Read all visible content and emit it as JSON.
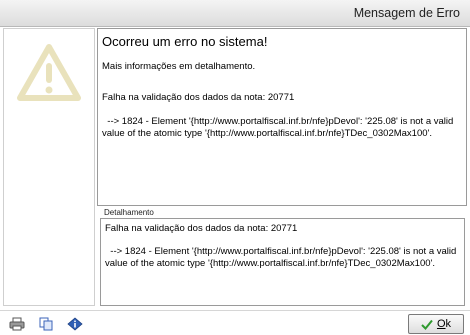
{
  "window": {
    "title": "Mensagem de Erro"
  },
  "message": {
    "heading": "Ocorreu um erro no sistema!",
    "more_info": "Mais informações em detalhamento.",
    "failure": "Falha na validação dos dados da nota: 20771",
    "detail": "  --> 1824 - Element '{http://www.portalfiscal.inf.br/nfe}pDevol': '225.08' is not a valid value of the atomic type '{http://www.portalfiscal.inf.br/nfe}TDec_0302Max100'."
  },
  "details": {
    "label": "Detalhamento",
    "failure": "Falha na validação dos dados da nota: 20771",
    "detail": "  --> 1824 - Element '{http://www.portalfiscal.inf.br/nfe}pDevol': '225.08' is not a valid value of the atomic type '{http://www.portalfiscal.inf.br/nfe}TDec_0302Max100'."
  },
  "toolbar": {
    "icons": [
      "printer-icon",
      "copy-icon",
      "info-icon"
    ],
    "ok_label": "Ok",
    "ok_hotkey": "O",
    "ok_rest": "k"
  },
  "colors": {
    "warning_icon": "#e9e2bc",
    "ok_check": "#2f9a2f"
  }
}
